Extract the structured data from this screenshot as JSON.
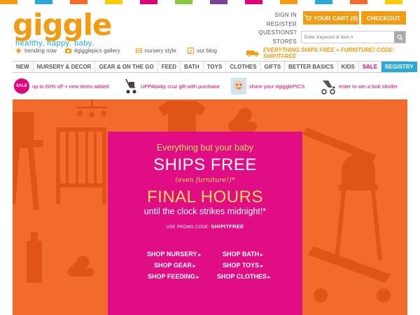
{
  "brand": {
    "logo": "giggle",
    "tagline": "healthy. happy. baby.",
    "accent": "#f39c12",
    "blue": "#2aa9d6",
    "magenta": "#e2007a"
  },
  "stripe_colors": [
    "#f39c12",
    "#e2007a",
    "#2aa9d6",
    "#8cc63f",
    "#f26a2c",
    "#7b3f98",
    "#ffcc00",
    "#2aa9d6",
    "#e2007a",
    "#f39c12",
    "#8cc63f",
    "#f26a2c",
    "#7b3f98",
    "#2aa9d6",
    "#e2007a",
    "#ffcc00",
    "#f39c12",
    "#8cc63f",
    "#2aa9d6",
    "#e2007a",
    "#f26a2c",
    "#7b3f98",
    "#ffcc00",
    "#8cc63f"
  ],
  "utility": {
    "sign_in": "SIGN IN",
    "register": "REGISTER",
    "questions": "QUESTIONS?",
    "stores": "STORES"
  },
  "cart": {
    "label": "YOUR CART (0)",
    "icon": "cart-icon"
  },
  "checkout": {
    "label": "CHECKOUT"
  },
  "search": {
    "placeholder": "Enter Keyword or item #",
    "icon": "search-icon"
  },
  "sublinks": [
    {
      "label": "trending now",
      "icon": "star-icon"
    },
    {
      "label": "#gigglepics gallery",
      "icon": "camera-icon"
    },
    {
      "label": "nursery style",
      "icon": "couch-icon"
    },
    {
      "label": "our blog",
      "icon": "pencil-icon"
    }
  ],
  "shipping_promo": "EVERYTHING SHIPS FREE + FURNITURE! CODE: SHIPITFREE",
  "nav": [
    "NEW",
    "NURSERY & DECOR",
    "GEAR & ON THE GO",
    "FEED",
    "BATH",
    "TOYS",
    "CLOTHES",
    "GIFTS",
    "BETTER BASICS",
    "KIDS",
    "SALE",
    "REGISTRY"
  ],
  "promos": {
    "sale_badge": "SALE",
    "sale_text": "up to 60% off + new items added",
    "uppababy_text": "UPPAbaby cruz gift with purchase",
    "share_text": "share your #gigglePICS",
    "enter_text": "enter to win a bob stroller"
  },
  "hero": {
    "line1": "Everything but your baby",
    "line2": "SHIPS FREE",
    "line3": "(even furniture!)*",
    "line4": "FINAL HOURS",
    "line5": "until the clock strikes midnight!*",
    "code_prefix": "USE PROMO CODE:",
    "code": "SHIPITFREE",
    "shop_links": [
      "SHOP NURSERY",
      "SHOP GEAR",
      "SHOP FEEDING",
      "SHOP BATH",
      "SHOP TOYS",
      "SHOP CLOTHES"
    ]
  }
}
